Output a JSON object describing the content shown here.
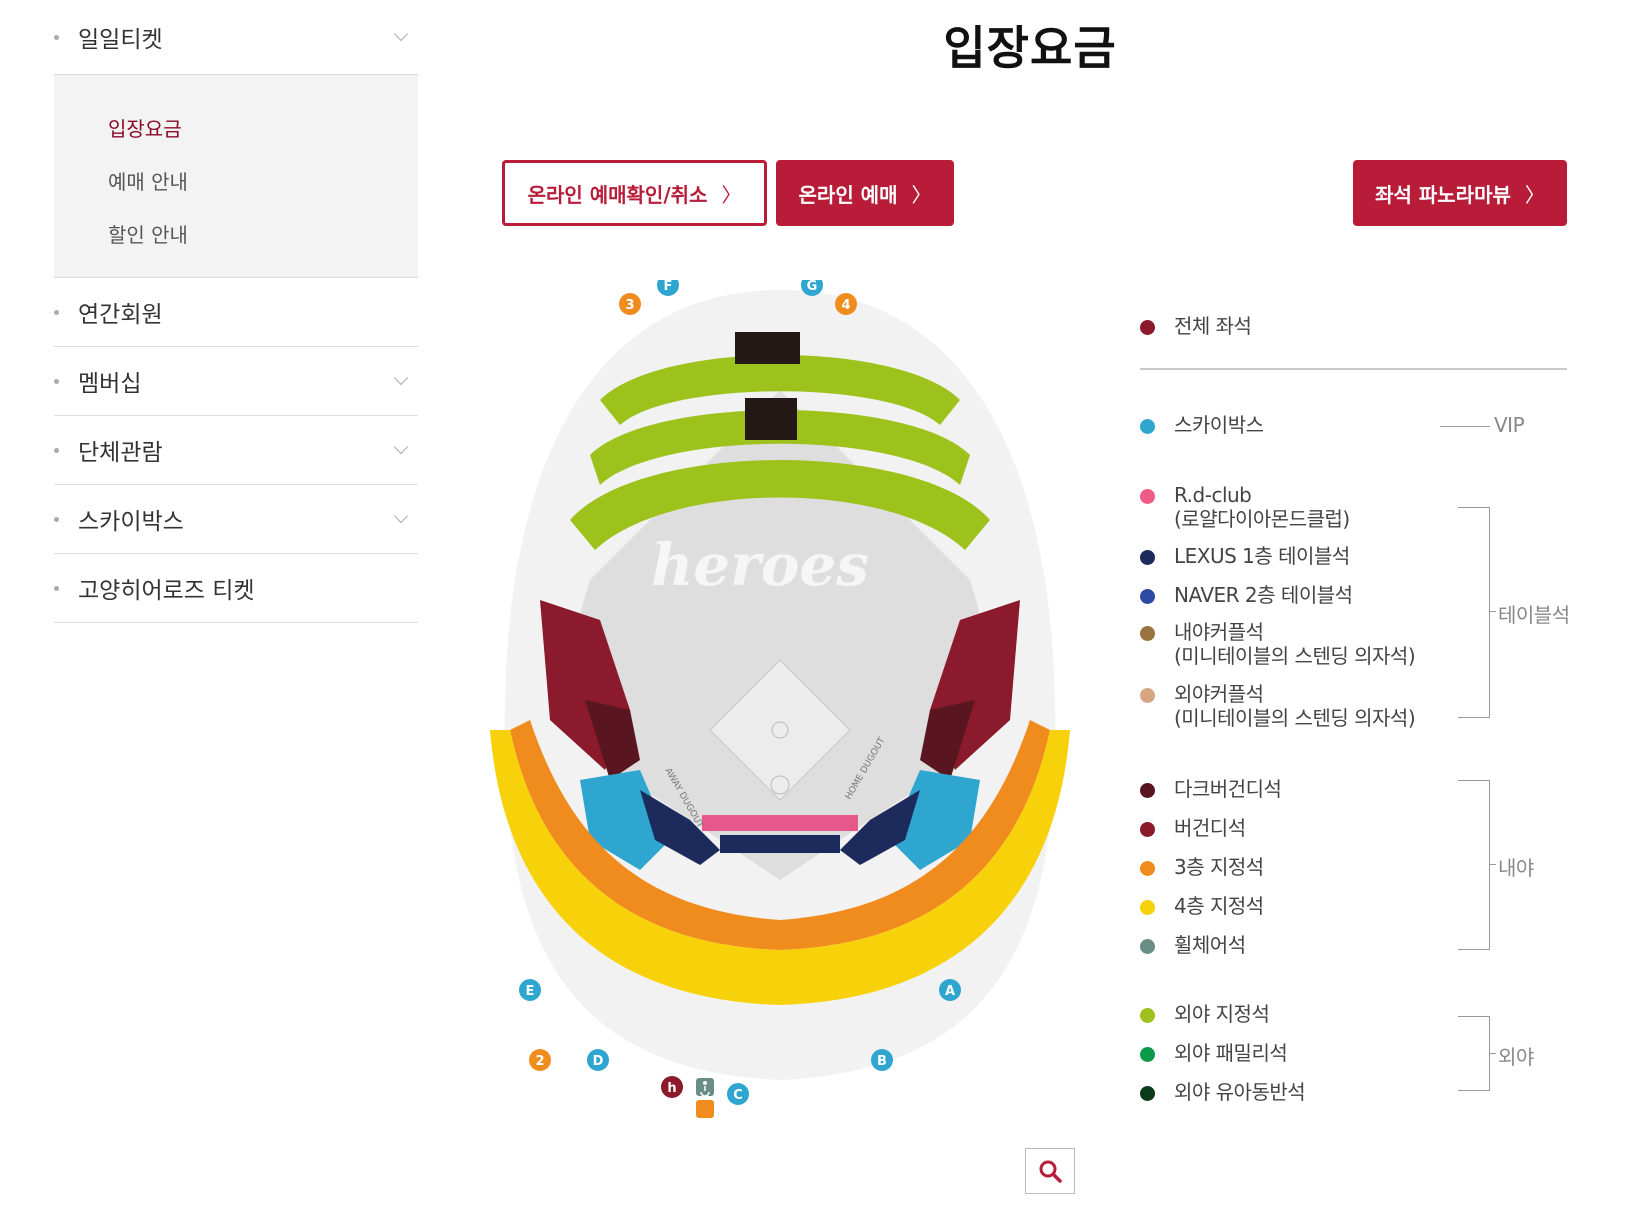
{
  "sidebar": {
    "items": [
      {
        "label": "일일티켓"
      },
      {
        "label": "연간회원"
      },
      {
        "label": "멤버십"
      },
      {
        "label": "단체관람"
      },
      {
        "label": "스카이박스"
      },
      {
        "label": "고양히어로즈 티켓"
      }
    ],
    "submenu": [
      {
        "label": "입장요금"
      },
      {
        "label": "예매 안내"
      },
      {
        "label": "할인 안내"
      }
    ]
  },
  "page": {
    "title": "입장요금"
  },
  "buttons": {
    "online_confirm": "온라인 예매확인/취소",
    "online_reserve": "온라인 예매",
    "panorama": "좌석 파노라마뷰",
    "arrow": "〉"
  },
  "map": {
    "logo": "heroes",
    "gates": {
      "A": "A",
      "B": "B",
      "C": "C",
      "D": "D",
      "E": "E",
      "F": "F",
      "G": "G",
      "n2": "2",
      "n3": "3",
      "n4": "4",
      "h": "h"
    },
    "labels": {
      "home": "HOME DUGOUT",
      "away": "AWAY DUGOUT"
    },
    "colors": {
      "outfield": "#9dc21c",
      "burgundy": "#8a1a2c",
      "darkburgundy": "#5a1620",
      "orange": "#f08c1e",
      "yellow": "#f7d20a",
      "skybox": "#2fa6cf",
      "navy": "#1c2a5c",
      "pink": "#e6578a",
      "black": "#231815"
    }
  },
  "legend": {
    "all": {
      "label": "전체 좌석",
      "color": "#8a1a2c"
    },
    "vip": {
      "label": "VIP",
      "items": [
        {
          "label": "스카이박스",
          "color": "#2fa6cf"
        }
      ]
    },
    "table": {
      "label": "테이블석",
      "items": [
        {
          "label": "R.d-club",
          "sub": "(로얄다이아몬드클럽)",
          "color": "#ef5a87"
        },
        {
          "label": "LEXUS 1층 테이블석",
          "color": "#1c2a5c"
        },
        {
          "label": "NAVER 2층 테이블석",
          "color": "#2c4aa2"
        },
        {
          "label": "내야커플석",
          "sub": "(미니테이블의 스텐딩 의자석)",
          "color": "#9a7240"
        },
        {
          "label": "외야커플석",
          "sub": "(미니테이블의 스텐딩 의자석)",
          "color": "#d8a583"
        }
      ]
    },
    "infield": {
      "label": "내야",
      "items": [
        {
          "label": "다크버건디석",
          "color": "#5a1620"
        },
        {
          "label": "버건디석",
          "color": "#8a1a2c"
        },
        {
          "label": "3층 지정석",
          "color": "#f08c1e"
        },
        {
          "label": "4층 지정석",
          "color": "#f7d20a"
        },
        {
          "label": "휠체어석",
          "color": "#6a8e86"
        }
      ]
    },
    "outfield": {
      "label": "외야",
      "items": [
        {
          "label": "외야 지정석",
          "color": "#9dc21c"
        },
        {
          "label": "외야 패밀리석",
          "color": "#0c9a4a"
        },
        {
          "label": "외야 유아동반석",
          "color": "#0a3a1a"
        }
      ]
    }
  }
}
